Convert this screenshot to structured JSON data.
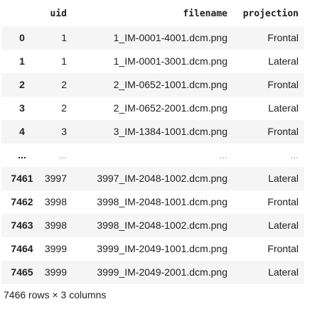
{
  "table": {
    "columns": [
      "",
      "uid",
      "filename",
      "projection"
    ],
    "rows": [
      {
        "index": "0",
        "uid": "1",
        "filename": "1_IM-0001-4001.dcm.png",
        "projection": "Frontal"
      },
      {
        "index": "1",
        "uid": "1",
        "filename": "1_IM-0001-3001.dcm.png",
        "projection": "Lateral"
      },
      {
        "index": "2",
        "uid": "2",
        "filename": "2_IM-0652-1001.dcm.png",
        "projection": "Frontal"
      },
      {
        "index": "3",
        "uid": "2",
        "filename": "2_IM-0652-2001.dcm.png",
        "projection": "Lateral"
      },
      {
        "index": "4",
        "uid": "3",
        "filename": "3_IM-1384-1001.dcm.png",
        "projection": "Frontal"
      },
      {
        "index": "...",
        "uid": "...",
        "filename": "...",
        "projection": "..."
      },
      {
        "index": "7461",
        "uid": "3997",
        "filename": "3997_IM-2048-1002.dcm.png",
        "projection": "Lateral"
      },
      {
        "index": "7462",
        "uid": "3998",
        "filename": "3998_IM-2048-1001.dcm.png",
        "projection": "Frontal"
      },
      {
        "index": "7463",
        "uid": "3998",
        "filename": "3998_IM-2048-1002.dcm.png",
        "projection": "Lateral"
      },
      {
        "index": "7464",
        "uid": "3999",
        "filename": "3999_IM-2049-1001.dcm.png",
        "projection": "Frontal"
      },
      {
        "index": "7465",
        "uid": "3999",
        "filename": "3999_IM-2049-2001.dcm.png",
        "projection": "Lateral"
      }
    ]
  },
  "shape_text": "7466 rows × 3 columns",
  "colors": {
    "stripe": "#f5f5f5",
    "text": "#212121"
  }
}
